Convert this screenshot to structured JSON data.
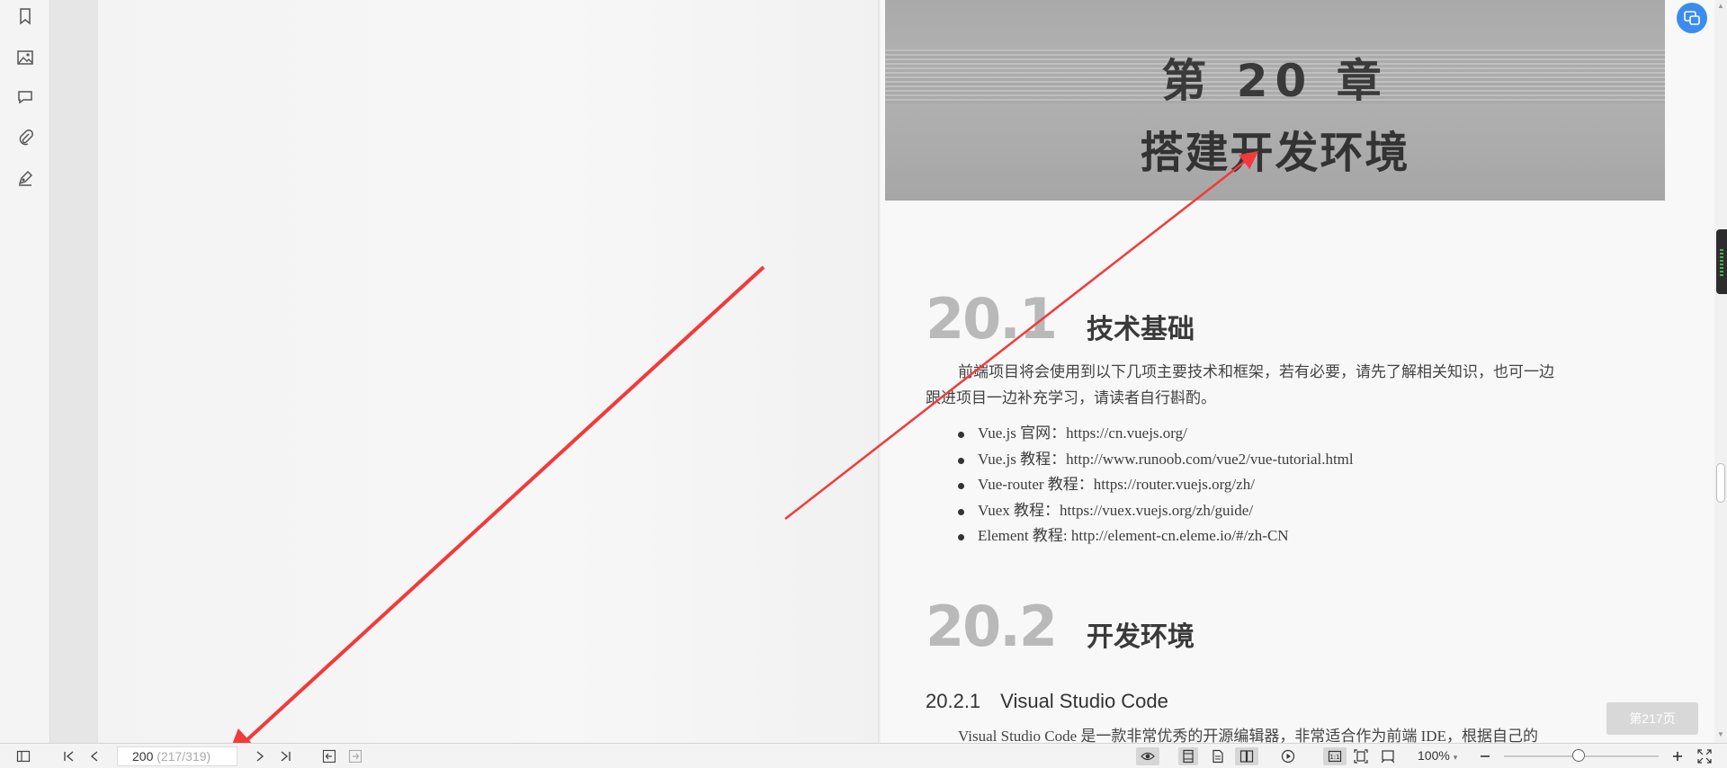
{
  "sidebar": {
    "items": [
      {
        "name": "bookmark-icon"
      },
      {
        "name": "image-icon"
      },
      {
        "name": "comment-icon"
      },
      {
        "name": "attachment-icon"
      },
      {
        "name": "signature-icon"
      }
    ]
  },
  "page": {
    "chapter_number": "第 20 章",
    "chapter_title": "搭建开发环境",
    "section1": {
      "number": "20.1",
      "title": "技术基础",
      "para_line1": "前端项目将会使用到以下几项主要技术和框架，若有必要，请先了解相关知识，也可一边",
      "para_line2": "跟进项目一边补充学习，请读者自行斟酌。",
      "bullets": [
        "Vue.js 官网：https://cn.vuejs.org/",
        "Vue.js 教程：http://www.runoob.com/vue2/vue-tutorial.html",
        "Vue-router 教程：https://router.vuejs.org/zh/",
        "Vuex 教程：https://vuex.vuejs.org/zh/guide/",
        "Element 教程: http://element-cn.eleme.io/#/zh-CN"
      ]
    },
    "section2": {
      "number": "20.2",
      "title": "开发环境"
    },
    "subsection": {
      "number": "20.2.1",
      "title": "Visual Studio Code"
    },
    "para2": "Visual Studio Code 是一款非常优秀的开源编辑器，非常适合作为前端 IDE，根据自己的"
  },
  "page_tip": "第217页",
  "statusbar": {
    "page_current": "200",
    "page_total": " (217/319)",
    "zoom": "100%"
  },
  "colors": {
    "annotation_arrow": "#f23a3a",
    "accent": "#3c8cf0"
  }
}
